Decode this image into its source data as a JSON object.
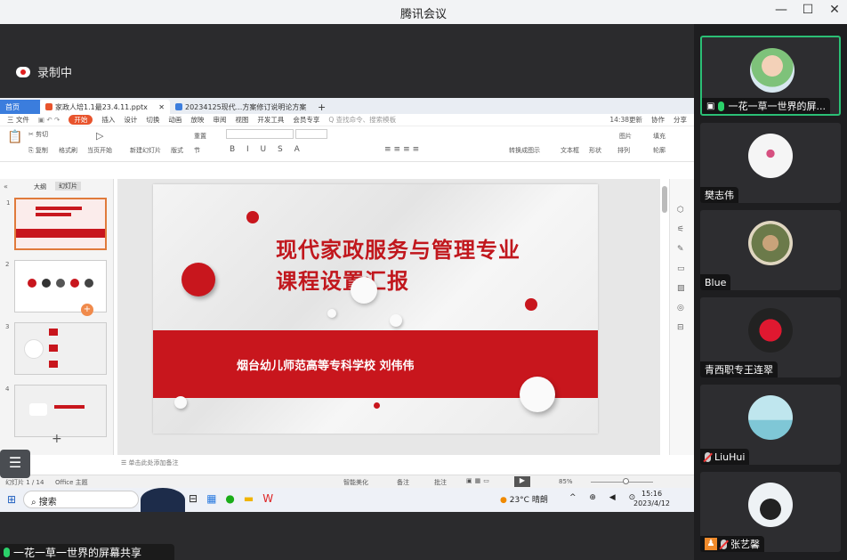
{
  "window": {
    "title": "腾讯会议",
    "minimize": "—",
    "maximize": "☐",
    "close": "✕"
  },
  "recording": {
    "label": "录制中"
  },
  "wps": {
    "tabs": [
      {
        "label": "首页"
      },
      {
        "label": "家政人培1.1最23.4.11.pptx"
      },
      {
        "label": "20234125现代...方案修订说明论方案"
      }
    ],
    "menu": [
      "三 文件",
      "开始",
      "插入",
      "设计",
      "切换",
      "动画",
      "放映",
      "审阅",
      "视图",
      "开发工具",
      "会员专享",
      "Q 查找命令、搜索模板"
    ],
    "menu_right": [
      "14:38更新",
      "协作",
      "分享"
    ],
    "ribbon": {
      "cut": "剪切",
      "copy": "复制",
      "format_painter": "格式刷",
      "play_current": "当页开始",
      "new_slide": "新建幻灯片",
      "layout": "版式",
      "section": "节",
      "reset": "重置",
      "textbox": "文本框",
      "shape": "形状",
      "arrange": "排列",
      "picture": "图片",
      "fill": "填充",
      "outline": "轮廓",
      "to_smartart": "转换成图示"
    },
    "panel_tabs": [
      "大纲",
      "幻灯片"
    ],
    "thumbs": [
      {
        "n": "1"
      },
      {
        "n": "2"
      },
      {
        "n": "3"
      },
      {
        "n": "4"
      }
    ],
    "slide": {
      "title1": "现代家政服务与管理专业",
      "title2": "课程设置汇报",
      "school": "烟台幼儿师范高等专科学校    刘伟伟"
    },
    "notes": "单击此处添加备注",
    "status": {
      "slide_count": "幻灯片 1 / 14",
      "theme": "Office 主题",
      "smart_beauty": "智能美化",
      "notes_btn": "备注",
      "comment_btn": "批注",
      "zoom": "85%"
    }
  },
  "taskbar": {
    "search": "搜索",
    "weather": "23°C  晴朗",
    "time": "15:16",
    "date": "2023/4/12"
  },
  "bottom": {
    "label": "一花一草一世界的屏幕共享"
  },
  "participants": [
    {
      "name": "一花一草一世界的屏...",
      "mic": "on",
      "screen": true
    },
    {
      "name": "樊志伟",
      "mic": "none"
    },
    {
      "name": "Blue",
      "mic": "none"
    },
    {
      "name": "青西职专王连翠",
      "mic": "none"
    },
    {
      "name": "LiuHui",
      "mic": "off"
    },
    {
      "name": "张艺馨",
      "mic": "off"
    }
  ],
  "colors": {
    "accent": "#c8161d",
    "speaking": "#2bbf75",
    "wps_orange": "#e8542d"
  }
}
